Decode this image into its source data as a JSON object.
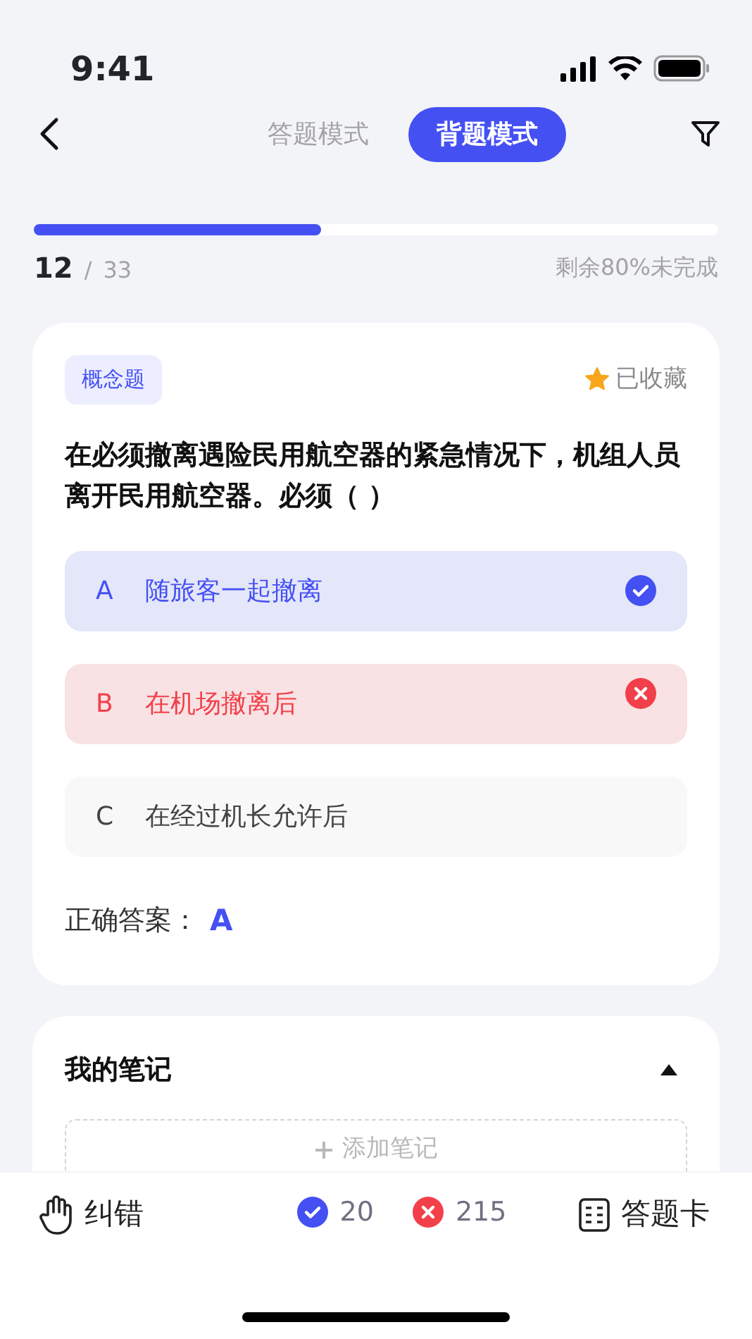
{
  "status_bar": {
    "time": "9:41"
  },
  "mode_tabs": [
    {
      "label": "答题模式",
      "selected": false
    },
    {
      "label": "背题模式",
      "selected": true
    }
  ],
  "progress": {
    "level": 0.42,
    "current": "12",
    "separator": "/",
    "total": "33",
    "remaining": "剩余80%未完成"
  },
  "question": {
    "type_tag": "概念题",
    "favorite": {
      "label": "已收藏",
      "on": true
    },
    "text": "在必须撤离遇险民用航空器的紧急情况下，机组人员离开民用航空器。必须（  ）",
    "options": [
      {
        "letter": "A",
        "text": "随旅客一起撤离",
        "kind": "correct"
      },
      {
        "letter": "B",
        "text": "在机场撤离后",
        "kind": "wrong"
      },
      {
        "letter": "C",
        "text": "在经过机长允许后",
        "kind": "plain"
      }
    ],
    "answer_label": "正确答案：",
    "answer": "A"
  },
  "notes": {
    "title": "我的笔记",
    "expanded": true,
    "add_button": "添加笔记"
  },
  "bottom_bar": {
    "report": "纠错",
    "correct_count": "20",
    "wrong_count": "215",
    "answer_card": "答题卡"
  }
}
